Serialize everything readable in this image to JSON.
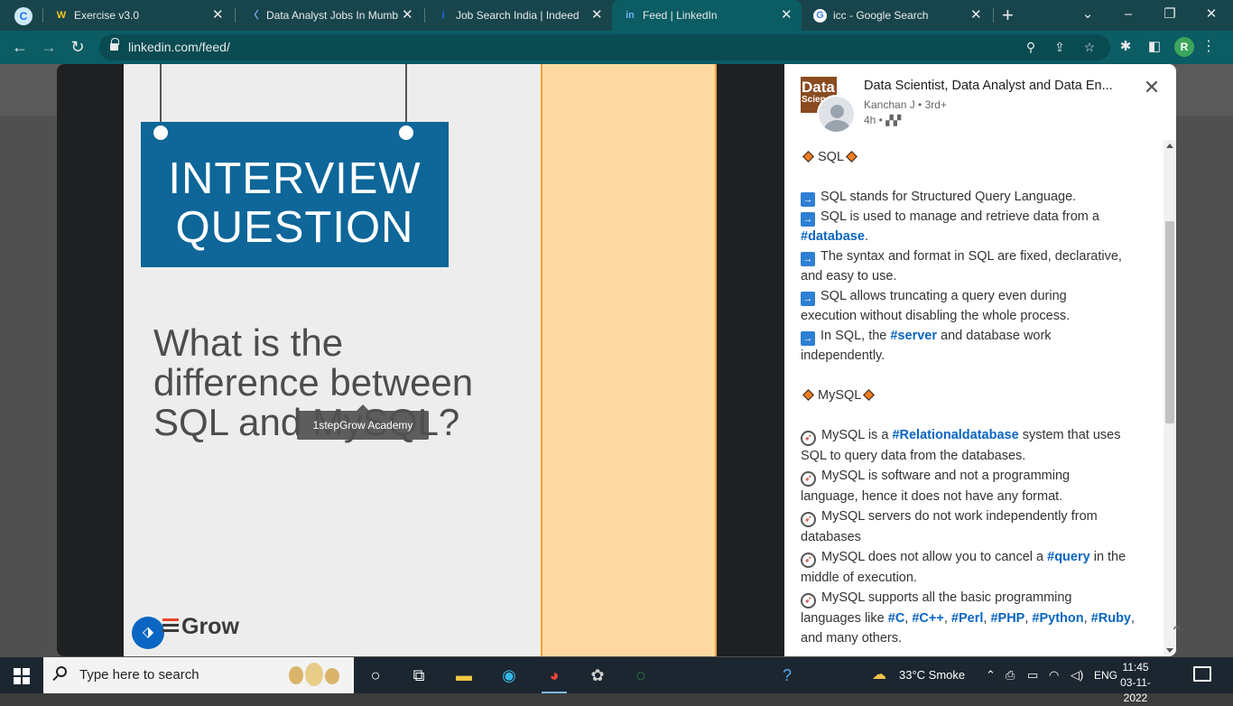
{
  "browser": {
    "tabs": [
      {
        "title": "Exercise v3.0",
        "favicon": "W",
        "active": false
      },
      {
        "title": "Data Analyst Jobs In Mumb",
        "favicon": "naukri",
        "active": false
      },
      {
        "title": "Job Search India | Indeed",
        "favicon": "i",
        "active": false
      },
      {
        "title": "Feed | LinkedIn",
        "favicon": "in",
        "active": true
      },
      {
        "title": "icc - Google Search",
        "favicon": "G",
        "active": false
      }
    ],
    "url": "linkedin.com/feed/",
    "profile_initial": "R",
    "colors": {
      "frame": "#18454b",
      "toolbar": "#0b5c63"
    }
  },
  "media": {
    "sign_line1": "INTERVIEW",
    "sign_line2": "QUESTION",
    "question_line1": "What is the",
    "question_line2": "difference between",
    "question_line3": "SQL and MySQL?",
    "tooltip": "1stepGrow Academy",
    "brand": "Grow",
    "colors": {
      "sign": "#0e6699",
      "band": "#ffd9a1"
    }
  },
  "post": {
    "logo_text": "Data",
    "logo_sub": "Scien",
    "title": "Data Scientist, Data Analyst and Data En...",
    "author": "Kanchan J • 3rd+",
    "time": "4h •",
    "sql_heading": "SQL",
    "sql_lines": {
      "l1": "SQL stands for Structured Query Language.",
      "l2a": "SQL is used to manage and retrieve data from a",
      "l2b_tag": "#database",
      "l2b_end": ".",
      "l3a": "The syntax and format in SQL are fixed, declarative,",
      "l3b": "and easy to use.",
      "l4a": "SQL allows truncating a query even during",
      "l4b": "execution without disabling the whole process.",
      "l5a": "In SQL, the ",
      "l5_tag": "#server",
      "l5a_end": " and database work",
      "l5b": "independently."
    },
    "mysql_heading": "MySQL",
    "mysql_lines": {
      "m1a": "MySQL is a ",
      "m1_tag": "#Relationaldatabase",
      "m1a_end": " system that uses",
      "m1b": "SQL to query data from the databases.",
      "m2a": "MySQL is software and not a programming",
      "m2b": "language, hence it does not have any format.",
      "m3a": "MySQL servers do not work independently from",
      "m3b": "databases",
      "m4a": "MySQL does not allow you to cancel a ",
      "m4_tag": "#query",
      "m4a_end": " in the",
      "m4b": "middle of execution.",
      "m5a": "MySQL supports all the basic programming",
      "m5b": "languages like ",
      "m5_tags": [
        "#C",
        "#C++",
        "#Perl",
        "#PHP",
        "#Python",
        "#Ruby"
      ],
      "m5c": "and many others."
    },
    "colors": {
      "hashtag": "#0a66c2",
      "diamond": "#f57d1f"
    }
  },
  "taskbar": {
    "search_placeholder": "Type here to search",
    "weather": "33°C  Smoke",
    "language": "ENG",
    "time": "11:45",
    "date": "03-11-2022"
  }
}
